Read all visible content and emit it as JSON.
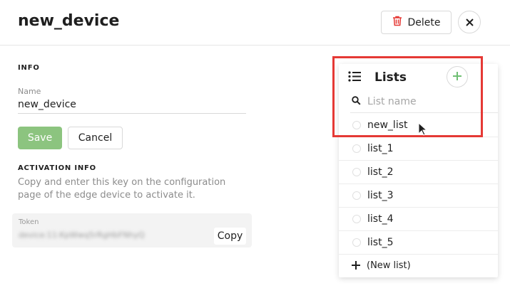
{
  "header": {
    "title": "new_device",
    "delete_label": "Delete"
  },
  "info": {
    "section_title": "INFO",
    "name_label": "Name",
    "name_value": "new_device",
    "save_label": "Save",
    "cancel_label": "Cancel"
  },
  "activation": {
    "section_title": "ACTIVATION INFO",
    "description": "Copy and enter this key on the configuration page of the edge device to activate it.",
    "token_label": "Token",
    "token_value": "device:11:KpWwq5rRgHbFNhyQ",
    "copy_label": "Copy"
  },
  "lists_dropdown": {
    "title": "Lists",
    "search_placeholder": "List name",
    "items": [
      {
        "label": "new_list",
        "hovered": true
      },
      {
        "label": "list_1"
      },
      {
        "label": "list_2"
      },
      {
        "label": "list_3"
      },
      {
        "label": "list_4"
      },
      {
        "label": "list_5"
      }
    ],
    "new_list_label": "(New list)"
  },
  "colors": {
    "save_button": "#8cc47f",
    "add_icon": "#6fbf73",
    "delete_icon": "#e53935",
    "highlight_box": "#e53935"
  },
  "icons": {
    "delete": "trash-icon",
    "close": "close-icon",
    "lists": "list-icon",
    "add": "plus-icon",
    "search": "search-icon",
    "new_list": "plus-icon"
  }
}
